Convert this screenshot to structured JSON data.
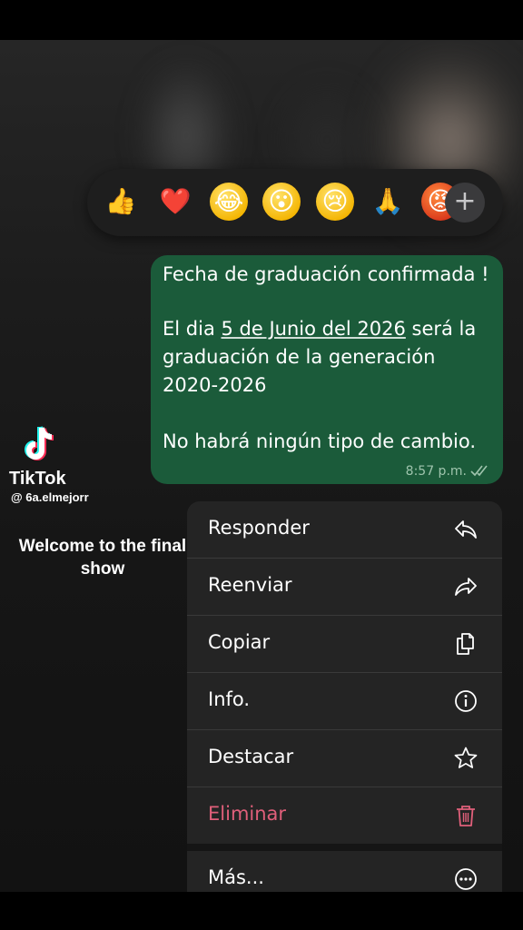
{
  "reactions": {
    "emojis": [
      {
        "name": "thumbs-up",
        "char": "👍"
      },
      {
        "name": "red-heart",
        "char": "❤️"
      },
      {
        "name": "tears-of-joy",
        "char": "😂"
      },
      {
        "name": "surprised-face",
        "char": "😮"
      },
      {
        "name": "crying-face",
        "char": "😢"
      },
      {
        "name": "folded-hands",
        "char": "🙏"
      },
      {
        "name": "angry-face",
        "char": "😡"
      }
    ],
    "more": "+"
  },
  "message": {
    "line1": "Fecha de graduación confirmada !",
    "line2_pre": "El dia ",
    "line2_link": "5 de Junio del 2026",
    "line2_post": " será la",
    "line3": "graduación de la generación",
    "line4": "2020-2026",
    "line5": "No habrá ningún tipo de cambio.",
    "time": "8:57 p.m.",
    "status_icon": "double-check-icon"
  },
  "overlay": {
    "brand": "TikTok",
    "handle": "@ 6a.elmejorr",
    "caption": "Welcome to the final show"
  },
  "menu": {
    "reply": "Responder",
    "forward": "Reenviar",
    "copy": "Copiar",
    "info": "Info.",
    "star": "Destacar",
    "delete": "Eliminar",
    "more": "Más..."
  },
  "colors": {
    "bubble": "#1b5b3a",
    "danger": "#e05f7a",
    "menu_bg": "#242424"
  }
}
